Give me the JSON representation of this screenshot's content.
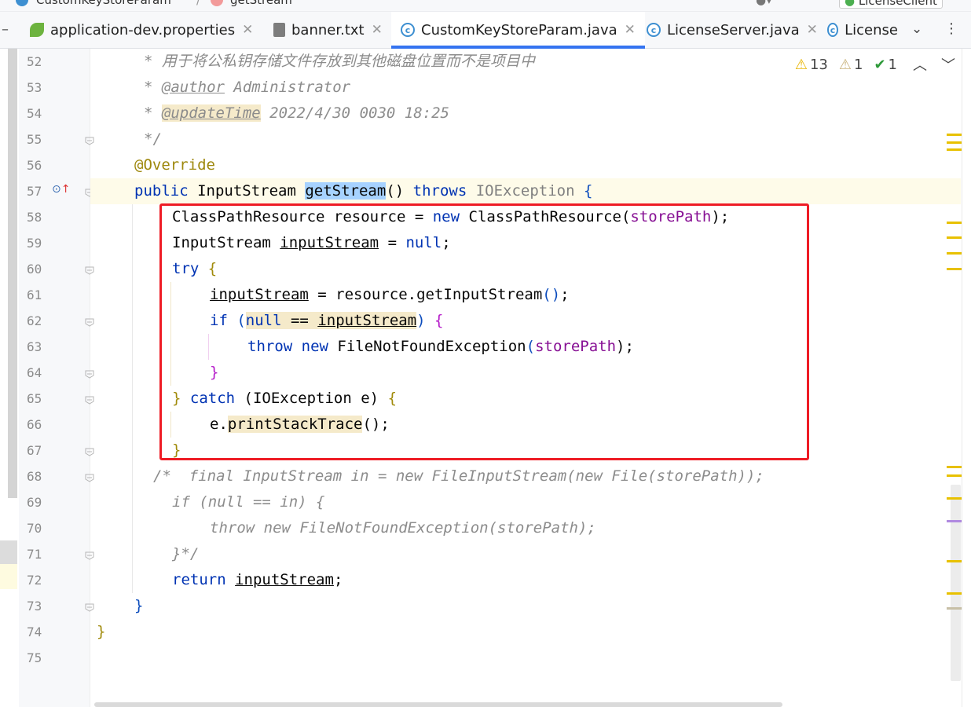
{
  "breadcrumb": [
    {
      "label": "CustomKeyStoreParam"
    },
    {
      "label": "getStream"
    }
  ],
  "top_right": {
    "run_config": "LicenseClient"
  },
  "tabs": [
    {
      "label": "application-dev.properties",
      "icon": "spring-leaf-icon",
      "active": false
    },
    {
      "label": "banner.txt",
      "icon": "text-file-icon",
      "active": false
    },
    {
      "label": "CustomKeyStoreParam.java",
      "icon": "java-class-icon",
      "active": true
    },
    {
      "label": "LicenseServer.java",
      "icon": "java-class-icon",
      "active": false
    },
    {
      "label": "License",
      "icon": "java-class-icon",
      "active": false
    }
  ],
  "inspections": {
    "warnings": "13",
    "weak_warnings": "1",
    "typos": "1"
  },
  "line_numbers": [
    "52",
    "53",
    "54",
    "55",
    "56",
    "57",
    "58",
    "59",
    "60",
    "61",
    "62",
    "63",
    "64",
    "65",
    "66",
    "67",
    "68",
    "69",
    "70",
    "71",
    "72",
    "73",
    "74",
    "75"
  ],
  "code": {
    "l52": "* 用于将公私钥存储文件存放到其他磁盘位置而不是项目中",
    "l53_star": "* ",
    "l53_tag": "@author",
    "l53_text": " Administrator",
    "l54_star": "* ",
    "l54_tag": "@updateTime",
    "l54_text": " 2022/4/30 0030 18:25",
    "l55": "*/",
    "l56": "@Override",
    "l57_a": "public",
    "l57_b": " InputStream ",
    "l57_c": "getStream",
    "l57_d": "() ",
    "l57_e": "throws",
    "l57_f": " IOException ",
    "l57_g": "{",
    "l58_a": "ClassPathResource resource = ",
    "l58_b": "new",
    "l58_c": " ClassPathResource(",
    "l58_d": "storePath",
    "l58_e": ");",
    "l59_a": "InputStream ",
    "l59_b": "inputStream",
    "l59_c": " = ",
    "l59_d": "null",
    "l59_e": ";",
    "l60_a": "try",
    "l60_b": " {",
    "l61_a": "inputStream",
    "l61_b": " = resource.getInputStream",
    "l61_c": "()",
    "l61_d": ";",
    "l62_a": "if",
    "l62_b": " (",
    "l62_c": "null",
    "l62_d": " == ",
    "l62_e": "inputStream",
    "l62_f": ")",
    "l62_g": " {",
    "l63_a": "throw",
    "l63_b": " new",
    "l63_c": " FileNotFoundException",
    "l63_d": "(",
    "l63_e": "storePath",
    "l63_f": ");",
    "l64": "}",
    "l65_a": "}",
    "l65_b": " catch",
    "l65_c": " (IOException e) ",
    "l65_d": "{",
    "l66_a": "e.",
    "l66_b": "printStackTrace",
    "l66_c": "();",
    "l67": "}",
    "l68": "/*  final InputStream in = new FileInputStream(new File(storePath));",
    "l69": "if (null == in) {",
    "l70": "throw new FileNotFoundException(storePath);",
    "l71": "}*/",
    "l72_a": "return",
    "l72_b": " ",
    "l72_c": "inputStream",
    "l72_d": ";",
    "l73": "}",
    "l74": "}"
  },
  "colors": {
    "keyword": "#0033b3",
    "annotation": "#9e880d",
    "comment": "#8c8c8c",
    "field": "#871094",
    "highlight_box": "#ee1c25",
    "tab_underline": "#3574f0"
  }
}
